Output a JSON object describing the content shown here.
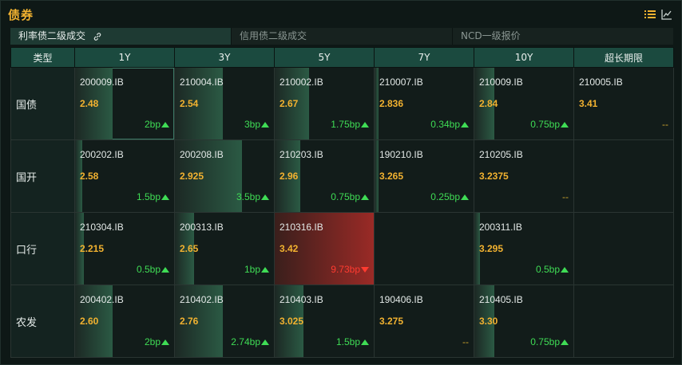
{
  "header": {
    "title": "债券",
    "list_icon": "list-icon",
    "chart_icon": "line-chart-icon",
    "accent": "#f2b230"
  },
  "tabs": [
    {
      "label": "利率债二级成交",
      "active": true,
      "icon": "link-icon"
    },
    {
      "label": "信用债二级成交",
      "active": false
    },
    {
      "label": "NCD一级报价",
      "active": false
    }
  ],
  "columns": [
    "类型",
    "1Y",
    "3Y",
    "5Y",
    "7Y",
    "10Y",
    "超长期限"
  ],
  "rows": [
    {
      "type": "国债",
      "cells": [
        {
          "bond": "200009.IB",
          "yield": "2.48",
          "change": "2bp",
          "dir": "up",
          "level": 0.38
        },
        {
          "bond": "210004.IB",
          "yield": "2.54",
          "change": "3bp",
          "dir": "up",
          "level": 0.48
        },
        {
          "bond": "210002.IB",
          "yield": "2.67",
          "change": "1.75bp",
          "dir": "up",
          "level": 0.35
        },
        {
          "bond": "210007.IB",
          "yield": "2.836",
          "change": "0.34bp",
          "dir": "up",
          "level": 0.04
        },
        {
          "bond": "210009.IB",
          "yield": "2.84",
          "change": "0.75bp",
          "dir": "up",
          "level": 0.2
        },
        {
          "bond": "210005.IB",
          "yield": "3.41",
          "change": "--",
          "dir": "none",
          "level": 0
        }
      ]
    },
    {
      "type": "国开",
      "cells": [
        {
          "bond": "200202.IB",
          "yield": "2.58",
          "change": "1.5bp",
          "dir": "up",
          "level": 0.07
        },
        {
          "bond": "200208.IB",
          "yield": "2.925",
          "change": "3.5bp",
          "dir": "up",
          "level": 0.68
        },
        {
          "bond": "210203.IB",
          "yield": "2.96",
          "change": "0.75bp",
          "dir": "up",
          "level": 0.26
        },
        {
          "bond": "190210.IB",
          "yield": "3.265",
          "change": "0.25bp",
          "dir": "up",
          "level": 0.04
        },
        {
          "bond": "210205.IB",
          "yield": "3.2375",
          "change": "--",
          "dir": "none",
          "level": 0
        },
        {
          "bond": "",
          "yield": "",
          "change": "",
          "dir": "empty",
          "level": 0
        }
      ]
    },
    {
      "type": "口行",
      "cells": [
        {
          "bond": "210304.IB",
          "yield": "2.215",
          "change": "0.5bp",
          "dir": "up",
          "level": 0.09
        },
        {
          "bond": "200313.IB",
          "yield": "2.65",
          "change": "1bp",
          "dir": "up",
          "level": 0.19
        },
        {
          "bond": "210316.IB",
          "yield": "3.42",
          "change": "9.73bp",
          "dir": "down",
          "level": 1.0
        },
        {
          "bond": "",
          "yield": "",
          "change": "",
          "dir": "empty",
          "level": 0
        },
        {
          "bond": "200311.IB",
          "yield": "3.295",
          "change": "0.5bp",
          "dir": "up",
          "level": 0.06
        },
        {
          "bond": "",
          "yield": "",
          "change": "",
          "dir": "empty",
          "level": 0
        }
      ]
    },
    {
      "type": "农发",
      "cells": [
        {
          "bond": "200402.IB",
          "yield": "2.60",
          "change": "2bp",
          "dir": "up",
          "level": 0.38
        },
        {
          "bond": "210402.IB",
          "yield": "2.76",
          "change": "2.74bp",
          "dir": "up",
          "level": 0.48
        },
        {
          "bond": "210403.IB",
          "yield": "3.025",
          "change": "1.5bp",
          "dir": "up",
          "level": 0.29
        },
        {
          "bond": "190406.IB",
          "yield": "3.275",
          "change": "--",
          "dir": "none",
          "level": 0
        },
        {
          "bond": "210405.IB",
          "yield": "3.30",
          "change": "0.75bp",
          "dir": "up",
          "level": 0.2
        },
        {
          "bond": "",
          "yield": "",
          "change": "",
          "dir": "empty",
          "level": 0
        }
      ]
    }
  ],
  "colors": {
    "up": "#3fdc55",
    "down": "#ff3b30",
    "header_bg": "#1b4a3f"
  }
}
